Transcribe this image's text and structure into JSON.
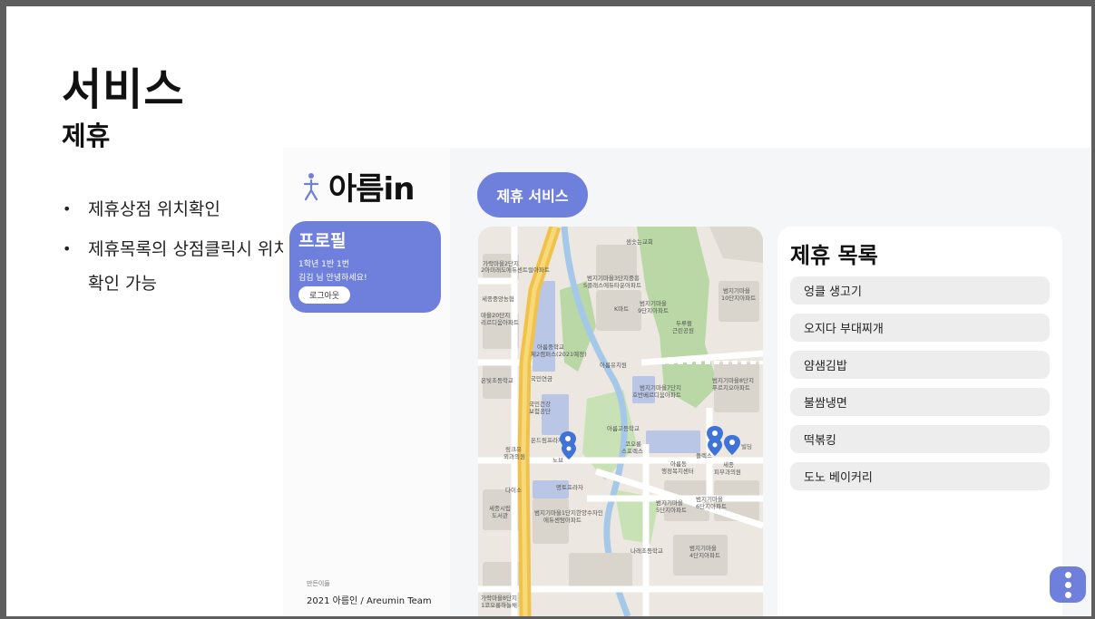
{
  "slide": {
    "title": "서비스",
    "subtitle": "제휴",
    "bullets": [
      "제휴상점 위치확인",
      "제휴목록의 상점클릭시 위치확인 가능"
    ]
  },
  "app": {
    "logo_text": "아름in",
    "profile": {
      "title": "프로필",
      "class_info": "1학년 1반 1번",
      "greeting": "김김 님 안녕하세요!",
      "logout_label": "로그아웃"
    },
    "credit_label": "만든이들",
    "credit": "2021 아름인 / Areumin Team",
    "header_label": "제휴 서비스",
    "partner_list": {
      "title": "제휴 목록",
      "items": [
        "엉클 생고기",
        "오지다 부대찌개",
        "얌샘김밥",
        "불쌈냉면",
        "떡볶킹",
        "도노 베이커리"
      ]
    },
    "map_labels": [
      "샘솟는교회",
      "가락마을2단지",
      "2아미래도에듀센트럴아파트",
      "범지기마을3단지중흥",
      "S클래스에듀타운아파트",
      "세종중앙농협",
      "K마트",
      "범지기마을",
      "9단지아파트",
      "범지기마을",
      "10단지아파트",
      "두루뜰",
      "근린공원",
      "마을20단지",
      "리르디움아파트",
      "아름중학교",
      "제2캠퍼스(2021예정)",
      "아름유치원",
      "국민연금",
      "온빛초등학교",
      "범지기마을7단지",
      "호반베르디움아파트",
      "범지기마을8단지",
      "푸르지오아파트",
      "국민건강",
      "보험공단",
      "아름고등학교",
      "온드림프라자",
      "코오롱",
      "스포렉스",
      "플렉스",
      "빌딩",
      "링크유",
      "외과의원",
      "노브",
      "아름동",
      "행정복지센터",
      "세종",
      "피부과의원",
      "다이소",
      "명토프라자",
      "범지기마을",
      "5단지아파트",
      "범지기마을",
      "6단지아파트",
      "세종시립",
      "도서관",
      "범지기마을1단지한양수자인",
      "에듀센텀아파트",
      "나래초등학교",
      "범지기마을",
      "4단지아파트",
      "가락마을8단지",
      "1코오롱하늘채"
    ],
    "colors": {
      "accent": "#6f7fdc",
      "pin": "#3f73d8"
    }
  }
}
